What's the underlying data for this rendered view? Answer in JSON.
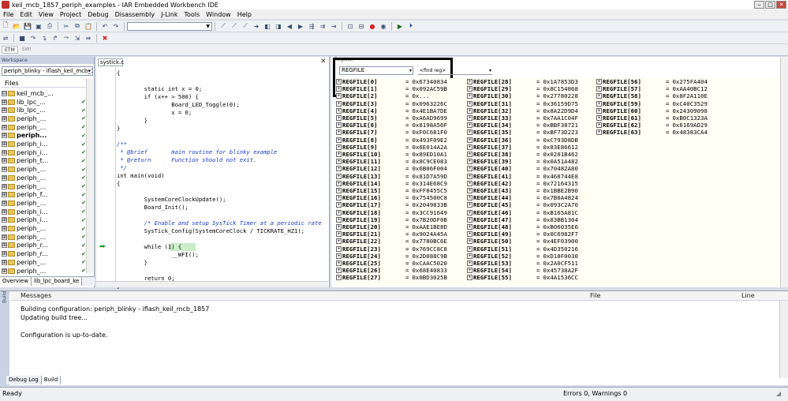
{
  "window": {
    "title": "keil_mcb_1857_periph_examples - IAR Embedded Workbench IDE"
  },
  "menu": [
    "File",
    "Edit",
    "View",
    "Project",
    "Debug",
    "Disassembly",
    "J-Link",
    "Tools",
    "Window",
    "Help"
  ],
  "toolbar3": {
    "tab1": "ETM",
    "tab2": "SWI"
  },
  "workspace": {
    "header": "Workspace",
    "config": "periph_blinky - iflash_keil_mcb_18",
    "files_header": "Files",
    "tree": [
      {
        "label": "keil_mcb_...",
        "expander": "⊟",
        "bold": false,
        "check": ""
      },
      {
        "label": "lib_lpc_...",
        "expander": "⊞",
        "bold": false,
        "check": "✔"
      },
      {
        "label": "lib_lpc_...",
        "expander": "⊞",
        "bold": false,
        "check": "✔"
      },
      {
        "label": "periph_...",
        "expander": "⊞",
        "bold": false,
        "check": "✔"
      },
      {
        "label": "periph_...",
        "expander": "⊞",
        "bold": false,
        "check": "✔"
      },
      {
        "label": "periph...",
        "expander": "⊞",
        "bold": true,
        "check": "✔"
      },
      {
        "label": "periph_i...",
        "expander": "⊞",
        "bold": false,
        "check": "✔"
      },
      {
        "label": "periph_i...",
        "expander": "⊞",
        "bold": false,
        "check": "✔"
      },
      {
        "label": "periph_t...",
        "expander": "⊞",
        "bold": false,
        "check": "✔"
      },
      {
        "label": "periph_...",
        "expander": "⊞",
        "bold": false,
        "check": "✔"
      },
      {
        "label": "periph_...",
        "expander": "⊞",
        "bold": false,
        "check": "✔"
      },
      {
        "label": "periph_...",
        "expander": "⊞",
        "bold": false,
        "check": "✔"
      },
      {
        "label": "periph_f...",
        "expander": "⊞",
        "bold": false,
        "check": "✔"
      },
      {
        "label": "periph_...",
        "expander": "⊞",
        "bold": false,
        "check": "✔"
      },
      {
        "label": "periph_i...",
        "expander": "⊞",
        "bold": false,
        "check": "✔"
      },
      {
        "label": "periph_i...",
        "expander": "⊞",
        "bold": false,
        "check": "✔"
      },
      {
        "label": "periph_...",
        "expander": "⊞",
        "bold": false,
        "check": "✔"
      },
      {
        "label": "periph_...",
        "expander": "⊞",
        "bold": false,
        "check": "✔"
      },
      {
        "label": "periph_r...",
        "expander": "⊞",
        "bold": false,
        "check": "✔"
      },
      {
        "label": "periph_r...",
        "expander": "⊞",
        "bold": false,
        "check": "✔"
      },
      {
        "label": "periph_...",
        "expander": "⊞",
        "bold": false,
        "check": "✔"
      },
      {
        "label": "periph_...",
        "expander": "⊞",
        "bold": false,
        "check": "✔"
      }
    ],
    "tabs": {
      "overview": "Overview",
      "lib": "lib_lpc_board_ke"
    }
  },
  "editor": {
    "tab": "systick.c",
    "lines": [
      {
        "text": "{",
        "cls": ""
      },
      {
        "text": "",
        "cls": ""
      },
      {
        "text": "        static int x = 0;",
        "cls": ""
      },
      {
        "text": "        if (x++ > 500) {",
        "cls": ""
      },
      {
        "text": "                Board_LED_Toggle(0);",
        "cls": ""
      },
      {
        "text": "                x = 0;",
        "cls": ""
      },
      {
        "text": "        }",
        "cls": ""
      },
      {
        "text": "}",
        "cls": ""
      },
      {
        "text": "",
        "cls": ""
      },
      {
        "text": "/**",
        "cls": "c-cm"
      },
      {
        "text": " * @brief       main routine for blinky example",
        "cls": "c-cm"
      },
      {
        "text": " * @return      Function should not exit.",
        "cls": "c-cm"
      },
      {
        "text": " */",
        "cls": "c-cm"
      },
      {
        "text": "int main(void)",
        "cls": ""
      },
      {
        "text": "{",
        "cls": ""
      },
      {
        "text": "",
        "cls": ""
      },
      {
        "text": "        SystemCoreClockUpdate();",
        "cls": ""
      },
      {
        "text": "        Board_Init();",
        "cls": ""
      },
      {
        "text": "",
        "cls": ""
      },
      {
        "text": "        /* Enable and setup SysTick Timer at a periodic rate",
        "cls": "c-cm"
      },
      {
        "text": "        SysTick_Config(SystemCoreClock / TICKRATE_HZ1);",
        "cls": ""
      },
      {
        "text": "",
        "cls": ""
      },
      {
        "text": "        while (1) {",
        "cls": ""
      },
      {
        "text": "                __WFI();",
        "cls": ""
      },
      {
        "text": "        }",
        "cls": ""
      },
      {
        "text": "",
        "cls": ""
      },
      {
        "text": "        return 0;",
        "cls": ""
      },
      {
        "text": "}",
        "cls": ""
      }
    ]
  },
  "register": {
    "title": "Register",
    "combo": "REGFILE",
    "find": "<find reg>",
    "col1": [
      [
        "REGFILE[0]",
        "0x67340834"
      ],
      [
        "REGFILE[1]",
        "0x092AC59B"
      ],
      [
        "REGFILE[2]",
        "0x..."
      ],
      [
        "REGFILE[3]",
        "0x0963226C"
      ],
      [
        "REGFILE[4]",
        "0x4E1BA7DE"
      ],
      [
        "REGFILE[5]",
        "0xA6AD9699"
      ],
      [
        "REGFILE[6]",
        "0x8198A56F"
      ],
      [
        "REGFILE[7]",
        "0xF0C681F0"
      ],
      [
        "REGFILE[8]",
        "0x493F09E2"
      ],
      [
        "REGFILE[9]",
        "0x6E014A2A"
      ],
      [
        "REGFILE[10]",
        "0x89ED10A1"
      ],
      [
        "REGFILE[11]",
        "0x8C9CE083"
      ],
      [
        "REGFILE[12]",
        "0x6B06F004"
      ],
      [
        "REGFILE[13]",
        "0x81D7A59D"
      ],
      [
        "REGFILE[14]",
        "0x314E68C9"
      ],
      [
        "REGFILE[15]",
        "0xFF8455C5"
      ],
      [
        "REGFILE[16]",
        "0x754500C8"
      ],
      [
        "REGFILE[17]",
        "0x2049833B"
      ],
      [
        "REGFILE[18]",
        "0x3CC91649"
      ],
      [
        "REGFILE[19]",
        "0x7B20DF0B"
      ],
      [
        "REGFILE[20]",
        "0xAAE1BE8D"
      ],
      [
        "REGFILE[21]",
        "0x9024A45A"
      ],
      [
        "REGFILE[22]",
        "0x7780BC6E"
      ],
      [
        "REGFILE[23]",
        "0x769CC8C8"
      ],
      [
        "REGFILE[24]",
        "0x2D088C9B"
      ],
      [
        "REGFILE[25]",
        "0xCAAC5020"
      ],
      [
        "REGFILE[26]",
        "0x68E40833"
      ],
      [
        "REGFILE[27]",
        "0x0BD3025B"
      ]
    ],
    "col2": [
      [
        "REGFILE[28]",
        "0x1A7853D3"
      ],
      [
        "REGFILE[29]",
        "0x8C154868"
      ],
      [
        "REGFILE[30]",
        "0x27780228"
      ],
      [
        "REGFILE[31]",
        "0x36159D75"
      ],
      [
        "REGFILE[32]",
        "0x8A22D9D4"
      ],
      [
        "REGFILE[33]",
        "0x7AA1C04F"
      ],
      [
        "REGFILE[34]",
        "0xBBF38721"
      ],
      [
        "REGFILE[35]",
        "0xBF73D223"
      ],
      [
        "REGFILE[36]",
        "0xC793D8DB"
      ],
      [
        "REGFILE[37]",
        "0x83E86612"
      ],
      [
        "REGFILE[38]",
        "0x0201B462"
      ],
      [
        "REGFILE[39]",
        "0x0A51A482"
      ],
      [
        "REGFILE[40]",
        "0x70482A80"
      ],
      [
        "REGFILE[41]",
        "0x468744E8"
      ],
      [
        "REGFILE[42]",
        "0x72164315"
      ],
      [
        "REGFILE[43]",
        "0x1BBE2B90"
      ],
      [
        "REGFILE[44]",
        "0x7B0A4824"
      ],
      [
        "REGFILE[45]",
        "0x093C2A70"
      ],
      [
        "REGFILE[46]",
        "0xB165A81C"
      ],
      [
        "REGFILE[47]",
        "0x83BB1304"
      ],
      [
        "REGFILE[48]",
        "0xB06035E6"
      ],
      [
        "REGFILE[49]",
        "0x0C6982F7"
      ],
      [
        "REGFILE[50]",
        "0x4EF03900"
      ],
      [
        "REGFILE[51]",
        "0x4D350216"
      ],
      [
        "REGFILE[52]",
        "0xD18F0030"
      ],
      [
        "REGFILE[53]",
        "0x2A0CF511"
      ],
      [
        "REGFILE[54]",
        "0x45738A2F"
      ],
      [
        "REGFILE[55]",
        "0x4A1536CC"
      ]
    ],
    "col3": [
      [
        "REGFILE[56]",
        "0x275FA404"
      ],
      [
        "REGFILE[57]",
        "0xAA40BC12"
      ],
      [
        "REGFILE[58]",
        "0x8F2A110E"
      ],
      [
        "REGFILE[59]",
        "0xC40C3529"
      ],
      [
        "REGFILE[60]",
        "0x24309098"
      ],
      [
        "REGFILE[61]",
        "0xB0C1323A"
      ],
      [
        "REGFILE[62]",
        "0x6169AD29"
      ],
      [
        "REGFILE[63]",
        "0x48383CA4"
      ]
    ]
  },
  "messages": {
    "side_label": "Build",
    "col_messages": "Messages",
    "col_file": "File",
    "col_line": "Line",
    "lines": [
      "Building configuration: periph_blinky - iflash_keil_mcb_1857",
      "Updating build tree...",
      "",
      "Configuration is up-to-date."
    ],
    "tabs": {
      "debug_log": "Debug Log",
      "build": "Build"
    }
  },
  "status": {
    "left": "Ready",
    "right": "Errors 0, Warnings 0"
  }
}
